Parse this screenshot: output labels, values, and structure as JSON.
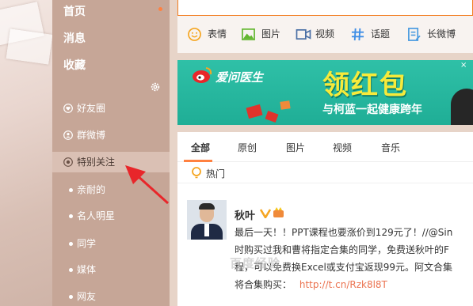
{
  "colors": {
    "sidebar_bg": "#c6a697",
    "accent": "#ff8140",
    "link": "#eb7350",
    "banner_green": "#1fae96"
  },
  "sidebar": {
    "top_items": [
      {
        "label": "首页"
      },
      {
        "label": "消息"
      },
      {
        "label": "收藏"
      }
    ],
    "groups": [
      {
        "label": "好友圈",
        "icon": "heart-circle-icon"
      },
      {
        "label": "群微博",
        "icon": "group-icon"
      },
      {
        "label": "特别关注",
        "icon": "target-icon"
      }
    ],
    "sub_items": [
      {
        "label": "亲耐的"
      },
      {
        "label": "名人明星"
      },
      {
        "label": "同学"
      },
      {
        "label": "媒体"
      },
      {
        "label": "网友"
      }
    ]
  },
  "composer": {
    "tools": [
      {
        "label": "表情",
        "icon": "smiley-icon"
      },
      {
        "label": "图片",
        "icon": "image-icon"
      },
      {
        "label": "视频",
        "icon": "video-icon"
      },
      {
        "label": "话题",
        "icon": "hashtag-icon"
      },
      {
        "label": "长微博",
        "icon": "document-icon"
      }
    ]
  },
  "banner": {
    "brand": "爱问医生",
    "headline": "领红包",
    "subline": "与柯蓝一起健康跨年"
  },
  "feed": {
    "tabs": [
      "全部",
      "原创",
      "图片",
      "视频",
      "音乐"
    ],
    "hot_label": "热门",
    "post": {
      "author": "秋叶",
      "lines": [
        "最后一天！！PPT课程也要涨价到129元了！//@Sin",
        "时购买过我和曹将指定合集的同学，免费送秋叶的F",
        "程，可以免费换Excel或支付宝返现99元。阿文合集"
      ],
      "last_line_prefix": "将合集购买：",
      "last_line_link": "http://t.cn/Rzk8l8T"
    }
  },
  "watermark": "百度经验"
}
